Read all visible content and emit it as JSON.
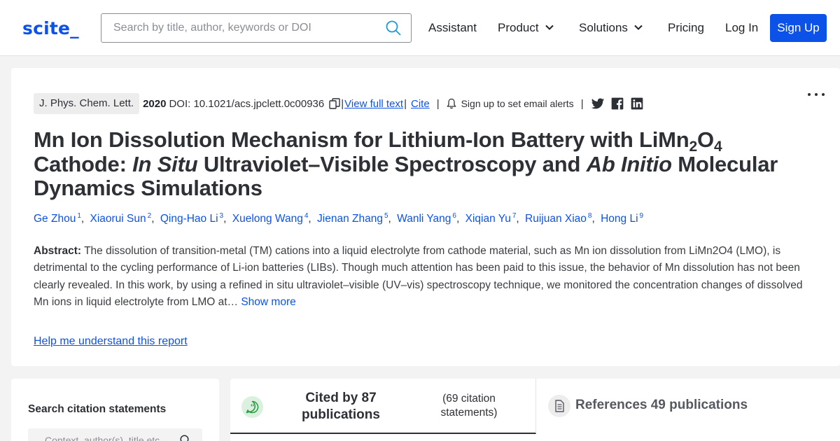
{
  "header": {
    "logo": "scite_",
    "search_placeholder": "Search by title, author, keywords or DOI",
    "nav": {
      "assistant": "Assistant",
      "product": "Product",
      "solutions": "Solutions",
      "pricing": "Pricing",
      "login": "Log In",
      "signup": "Sign Up"
    }
  },
  "article": {
    "journal": "J. Phys. Chem. Lett.",
    "year": "2020",
    "doi": "DOI: 10.1021/acs.jpclett.0c00936",
    "view_full_text": "View full text",
    "cite": "Cite",
    "alerts": "Sign up to set email alerts",
    "title": {
      "part1": "Mn Ion Dissolution Mechanism for Lithium-Ion Battery with LiMn",
      "sub1": "2",
      "part2": "O",
      "sub2": "4",
      "part3": " Cathode: ",
      "italic1": "In Situ",
      "part4": " Ultraviolet–Visible Spectroscopy and ",
      "italic2": "Ab Initio",
      "part5": " Molecular Dynamics Simulations"
    },
    "authors": [
      {
        "name": "Ge Zhou",
        "num": "1"
      },
      {
        "name": "Xiaorui Sun",
        "num": "2"
      },
      {
        "name": "Qing-Hao Li",
        "num": "3"
      },
      {
        "name": "Xuelong Wang",
        "num": "4"
      },
      {
        "name": "Jienan Zhang",
        "num": "5"
      },
      {
        "name": "Wanli Yang",
        "num": "6"
      },
      {
        "name": "Xiqian Yu",
        "num": "7"
      },
      {
        "name": "Ruijuan Xiao",
        "num": "8"
      },
      {
        "name": "Hong Li",
        "num": "9"
      }
    ],
    "abstract_label": "Abstract:",
    "abstract_text": "The dissolution of transition-metal (TM) cations into a liquid electrolyte from cathode material, such as Mn ion dissolution from LiMn2O4 (LMO), is detrimental to the cycling performance of Li-ion batteries (LIBs). Though much attention has been paid to this issue, the behavior of Mn dissolution has not been clearly revealed. In this work, by using a refined in situ ultraviolet–visible (UV–vis) spectroscopy technique, we monitored the concentration changes of dissolved Mn ions in liquid electrolyte from LMO at…",
    "show_more": "Show more",
    "help_link": "Help me understand this report"
  },
  "citations_panel": {
    "heading": "Search citation statements",
    "placeholder": "Context, author(s), title etc"
  },
  "tabs": {
    "cited_by": "Cited by 87 publications",
    "citation_statements": "(69 citation statements)",
    "references": "References 49 publications"
  },
  "colors": {
    "brand": "#0d52e8",
    "cite_icon": "#2e9e44"
  }
}
